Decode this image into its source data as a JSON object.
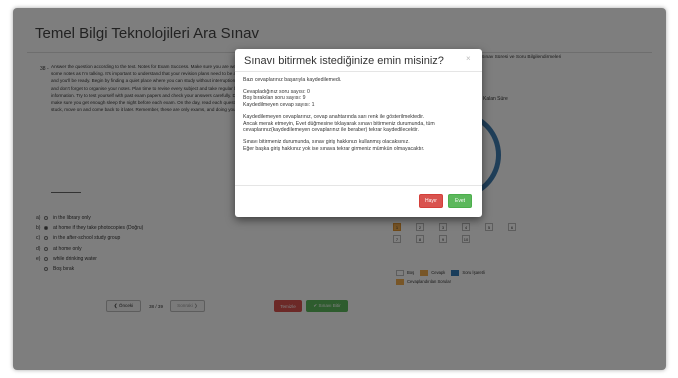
{
  "page": {
    "title": "Temel Bilgi Teknolojileri Ara Sınav"
  },
  "question": {
    "number": "38 -",
    "text": "Answer the question according to the text. Notes for Exam Success. Make sure you are well prepared for the exams next week. So, make some notes as I'm talking. It's important to understand that your revision plans need to be as thorough and flexible as possible, so start early and you'll be ready. Begin by finding a quiet place where you can study without interruptions. You might find the library or a study group useful, and don't forget to organise your notes. Plan time to revise every subject and take regular breaks, because rest helps your brain process information. Try to test yourself with past exam papers and check your answers carefully. Don't leave everything until the last minute, and make sure you get enough sleep the night before each exam. On the day, read each question carefully before you start writing. If you get stuck, move on and come back to it later. Remember, these are only exams, and doing your best is what matters most. Good luck to you all."
  },
  "options": [
    {
      "letter": "a)",
      "text": "in the library only",
      "selected": false
    },
    {
      "letter": "b)",
      "text": "at home if they take photocopies (Doğru)",
      "selected": true
    },
    {
      "letter": "c)",
      "text": "in the after-school study group",
      "selected": false
    },
    {
      "letter": "d)",
      "text": "at home only",
      "selected": false
    },
    {
      "letter": "e)",
      "text": "while drinking water",
      "selected": false
    },
    {
      "letter": "",
      "text": "Boş bırak",
      "selected": false
    }
  ],
  "navigation": {
    "prev": "❮ Önceki",
    "page_indicator": "38 / 39",
    "next": "Sonraki ❯",
    "clear": "Temizle",
    "finish": "✔ Sınavı Bitir"
  },
  "right_panel": {
    "title": "Sınav Süresi ve Soru Bilgilendirmeleri",
    "timer": "Kalan Süre"
  },
  "grid": {
    "rows": [
      [
        {
          "n": "1",
          "answered": true
        },
        {
          "n": "2",
          "answered": false
        },
        {
          "n": "3",
          "answered": false
        },
        {
          "n": "4",
          "answered": false
        },
        {
          "n": "5",
          "answered": false
        },
        {
          "n": "6",
          "answered": false
        }
      ],
      [
        {
          "n": "7",
          "answered": false
        },
        {
          "n": "8",
          "answered": false
        },
        {
          "n": "9",
          "answered": false
        },
        {
          "n": "10",
          "answered": false
        }
      ]
    ]
  },
  "legend": [
    {
      "swatch": "empty",
      "label": "Boş"
    },
    {
      "swatch": "orange",
      "label": "Cevaplı"
    },
    {
      "swatch": "blue",
      "label": "Soru İşaretli"
    }
  ],
  "legend_note": "Cevaplandırılan Sorular",
  "modal": {
    "title": "Sınavı bitirmek istediğinize emin misiniz?",
    "close": "×",
    "lines": [
      "Bazı cevaplarınız başarıyla kaydedilemedi.",
      "",
      "Cevapladığınız soru sayısı: 0",
      "Boş bırakılan soru sayısı: 9",
      "Kaydedilmeyen cevap sayısı: 1",
      "",
      "Kaydedilemeyen cevaplarınız, cevap anahtarında sarı renk ile gösterilmektedir.",
      "Ancak merak etmeyin, Evet düğmesine tıklayarak sınavı bitirmeniz durumunda, tüm",
      "cevaplarınız(kaydedilemeyen cevaplarınız ile beraber) tekrar kaydedilecektir.",
      "",
      "Sınavı bitirmeniz durumunda, sınav giriş hakkınızı kullanmış olacaksınız.",
      "Eğer başka giriş hakkınız yok ise sınava tekrar girmeniz mümkün olmayacaktır."
    ],
    "no": "Hayır",
    "yes": "Evet"
  }
}
